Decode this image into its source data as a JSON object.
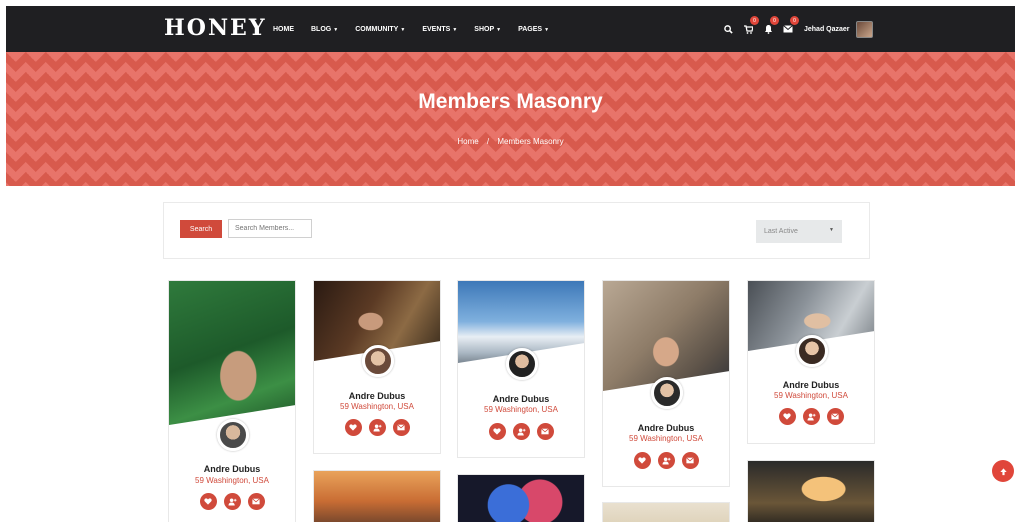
{
  "brand": {
    "logo": "HONEY",
    "accent": "#d04a3b",
    "nav_bg": "#1f1f22"
  },
  "nav": {
    "items": [
      {
        "label": "HOME",
        "caret": ""
      },
      {
        "label": "BLOG",
        "caret": "▼"
      },
      {
        "label": "COMMUNITY",
        "caret": "▼"
      },
      {
        "label": "EVENTS",
        "caret": "▼"
      },
      {
        "label": "SHOP",
        "caret": "▼"
      },
      {
        "label": "PAGES",
        "caret": "▼"
      }
    ],
    "icons": [
      "search-icon",
      "cart-icon",
      "bell-icon",
      "mail-icon"
    ],
    "badges": {
      "cart": "0",
      "bell": "0",
      "mail": "0"
    },
    "user_name": "Jehad Qazaer"
  },
  "hero": {
    "title": "Members Masonry",
    "breadcrumb_home": "Home",
    "breadcrumb_sep": "/",
    "breadcrumb_current": "Members Masonry"
  },
  "search": {
    "button_label": "Search",
    "placeholder": "Search Members...",
    "sort_selected": "Last Active"
  },
  "members": [
    {
      "name": "Andre Dubus",
      "location": "59 Washington, USA"
    },
    {
      "name": "Andre Dubus",
      "location": "59 Washington, USA"
    },
    {
      "name": "Andre Dubus",
      "location": "59 Washington, USA"
    },
    {
      "name": "Andre Dubus",
      "location": "59 Washington, USA"
    },
    {
      "name": "Andre Dubus",
      "location": "59 Washington, USA"
    }
  ],
  "action_icons": [
    "heart-icon",
    "add-friend-icon",
    "message-icon"
  ],
  "scroll_top_icon": "arrow-up-icon"
}
